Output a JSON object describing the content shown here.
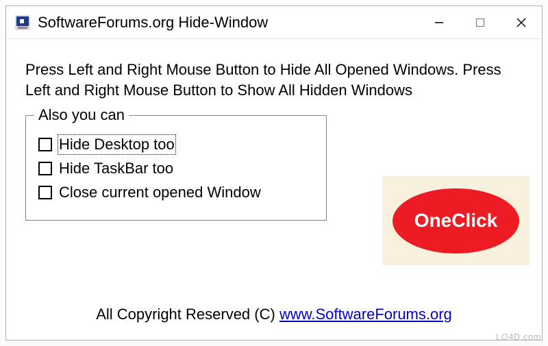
{
  "window": {
    "title": "SoftwareForums.org Hide-Window"
  },
  "instructions": "Press Left and Right Mouse Button to Hide All Opened Windows.  Press Left and Right Mouse Button to Show All Hidden Windows",
  "fieldset": {
    "legend": "Also you can",
    "options": [
      {
        "label": "Hide Desktop too",
        "checked": false,
        "focused": true
      },
      {
        "label": "Hide TaskBar too",
        "checked": false,
        "focused": false
      },
      {
        "label": "Close current opened Window",
        "checked": false,
        "focused": false
      }
    ]
  },
  "oneclick_label": "OneClick",
  "copyright": {
    "text": "All Copyright Reserved (C) ",
    "link_text": "www.SoftwareForums.org"
  },
  "watermark": "LO4D.com"
}
